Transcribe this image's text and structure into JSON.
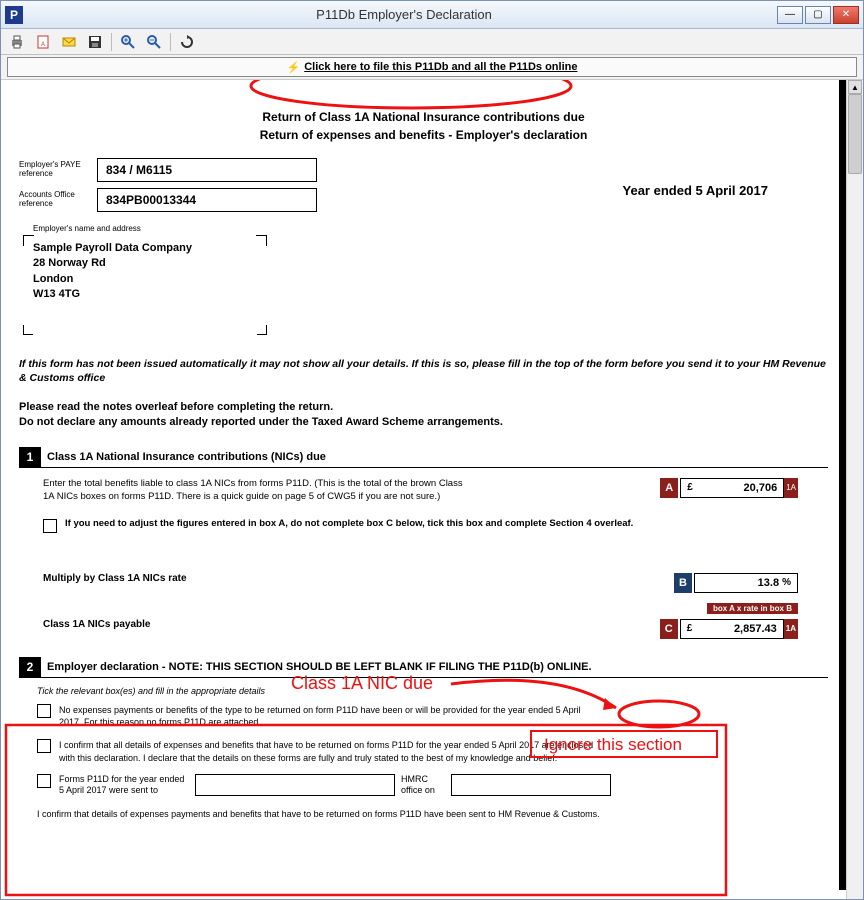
{
  "window": {
    "title": "P11Db Employer's Declaration"
  },
  "file_bar": {
    "label": "Click here to file this P11Db and all the P11Ds online"
  },
  "doc": {
    "header_line1": "Return of Class 1A National Insurance contributions due",
    "header_line2": "Return of expenses and benefits - Employer's declaration",
    "paye_ref_label": "Employer's PAYE reference",
    "paye_ref": "834 / M6115",
    "ao_ref_label": "Accounts Office reference",
    "ao_ref": "834PB00013344",
    "year_end": "Year ended 5 April 2017",
    "employer_label": "Employer's name and address",
    "employer_name": "Sample Payroll Data Company",
    "employer_addr1": "28 Norway Rd",
    "employer_city": "London",
    "employer_postcode": "W13 4TG",
    "note1": "If this form has not been issued automatically it may not show all your details. If this is so, please fill in the top of the form before you send it to your HM Revenue & Customs office",
    "note2a": "Please read the notes overleaf before completing the return.",
    "note2b": "Do not declare any amounts already reported under the Taxed Award Scheme arrangements.",
    "s1": {
      "title": "Class 1A National Insurance contributions (NICs) due",
      "enter_text": "Enter the total benefits liable to class 1A NICs from forms P11D. (This is the total of the brown Class 1A NICs boxes on forms P11D. There is a quick guide on page 5 of CWG5 if you are not sure.)",
      "boxA_label": "A",
      "boxA_value": "20,706",
      "boxA_suffix": "1A",
      "adjust_text": "If you need to adjust the figures entered in box A, do not complete box C below, tick this box and complete Section 4 overleaf.",
      "mult_text": "Multiply by Class 1A NICs rate",
      "boxB_label": "B",
      "boxB_value": "13.8",
      "boxB_suffix": "%",
      "payable_text": "Class 1A NICs payable",
      "boxC_note": "box A x rate in box B",
      "boxC_label": "C",
      "boxC_value": "2,857.43",
      "boxC_suffix": "1A"
    },
    "s2": {
      "title": "Employer declaration - NOTE: THIS SECTION SHOULD BE LEFT BLANK IF FILING THE P11D(b) ONLINE.",
      "tick_label": "Tick the relevant box(es) and fill in the appropriate details",
      "dec1": "No expenses payments or benefits of the type to be returned on form P11D have been or will be provided for the year ended 5 April 2017. For this reason no forms P11D are attached",
      "dec2": "I confirm that all details of expenses and benefits that have to be returned on forms P11D for the year ended 5 April 2017 are enclosed with this declaration. I declare that the details on these forms are fully and truly stated to the best of my knowledge and belief.",
      "dec3_a": "Forms P11D for the year ended 5 April 2017 were sent to",
      "dec3_b": "HMRC office on",
      "confirm": "I confirm that details of expenses payments and benefits that have to be returned on forms P11D have been sent to HM Revenue & Customs."
    }
  },
  "annotations": {
    "class1a_due": "Class 1A NIC due",
    "ignore_section": "Ignore this section"
  }
}
